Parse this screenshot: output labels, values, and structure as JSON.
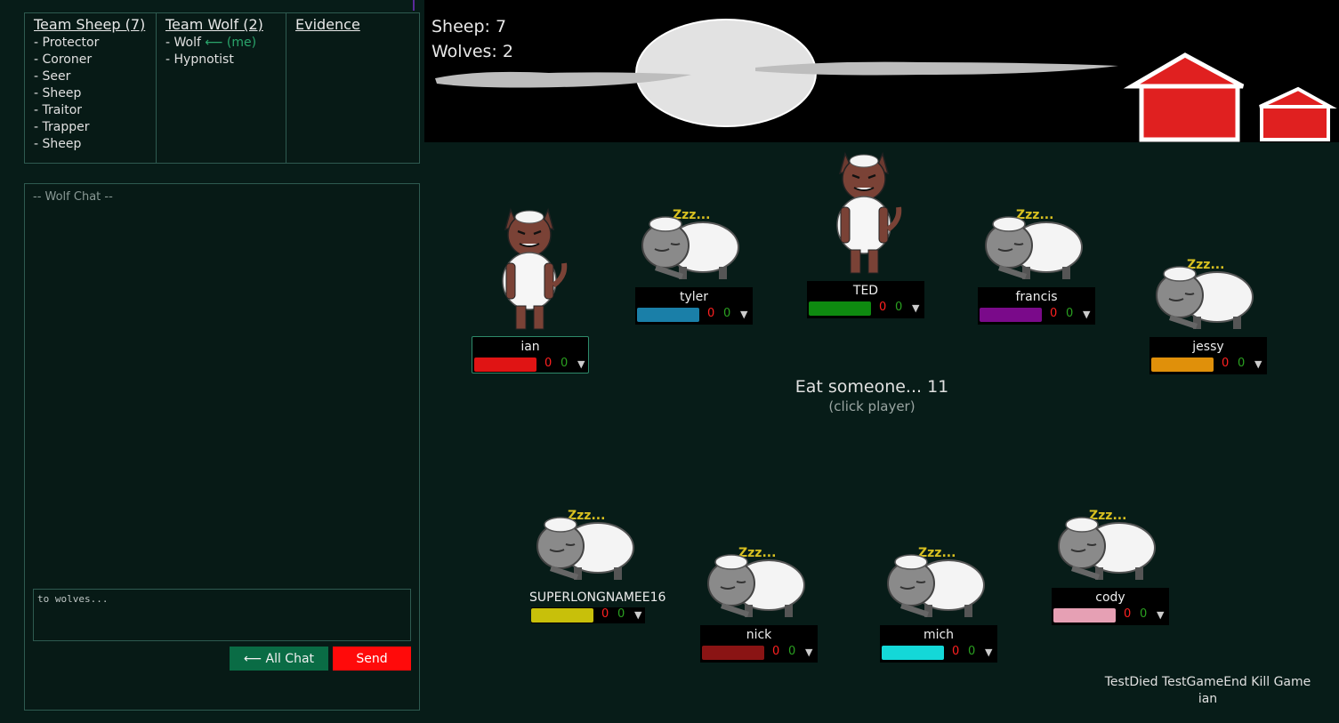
{
  "roles": {
    "sheep_header": "Team Sheep (7)",
    "sheep_roles": [
      "- Protector",
      "- Coroner",
      "- Seer",
      "- Sheep",
      "- Traitor",
      "- Trapper",
      "- Sheep"
    ],
    "wolf_header": "Team Wolf (2)",
    "wolf_roles": [
      "- Wolf",
      "- Hypnotist"
    ],
    "wolf_me": "⟵ (me)",
    "evidence_header": "Evidence"
  },
  "chat": {
    "title": "-- Wolf Chat --",
    "placeholder": "to wolves...",
    "all_chat_label": "⟵ All Chat",
    "send_label": "Send"
  },
  "counts": {
    "sheep": "Sheep: 7",
    "wolves": "Wolves: 2"
  },
  "prompt": {
    "main": "Eat someone... 11",
    "sub": "(click player)"
  },
  "players": [
    {
      "name": "ian",
      "color": "#e01414",
      "v1": "0",
      "v2": "0",
      "dd": "▼",
      "kind": "wolf"
    },
    {
      "name": "tyler",
      "color": "#1a7fa8",
      "v1": "0",
      "v2": "0",
      "dd": "▼",
      "kind": "sheep"
    },
    {
      "name": "TED",
      "color": "#0e8a10",
      "v1": "0",
      "v2": "0",
      "dd": "▼",
      "kind": "wolf"
    },
    {
      "name": "francis",
      "color": "#7a0a8a",
      "v1": "0",
      "v2": "0",
      "dd": "▼",
      "kind": "sheep"
    },
    {
      "name": "jessy",
      "color": "#e0900a",
      "v1": "0",
      "v2": "0",
      "dd": "▼",
      "kind": "sheep"
    },
    {
      "name": "SUPERLONGNAMEE16",
      "color": "#c8c00a",
      "v1": "0",
      "v2": "0",
      "dd": "▼",
      "kind": "sheep"
    },
    {
      "name": "nick",
      "color": "#8a1414",
      "v1": "0",
      "v2": "0",
      "dd": "▼",
      "kind": "sheep"
    },
    {
      "name": "mich",
      "color": "#14d8d8",
      "v1": "0",
      "v2": "0",
      "dd": "▼",
      "kind": "sheep"
    },
    {
      "name": "cody",
      "color": "#e6a0b4",
      "v1": "0",
      "v2": "0",
      "dd": "▼",
      "kind": "sheep"
    }
  ],
  "debug": {
    "test_died": "TestDied",
    "test_game_end": "TestGameEnd",
    "kill_game": "Kill Game",
    "user": "ian"
  }
}
